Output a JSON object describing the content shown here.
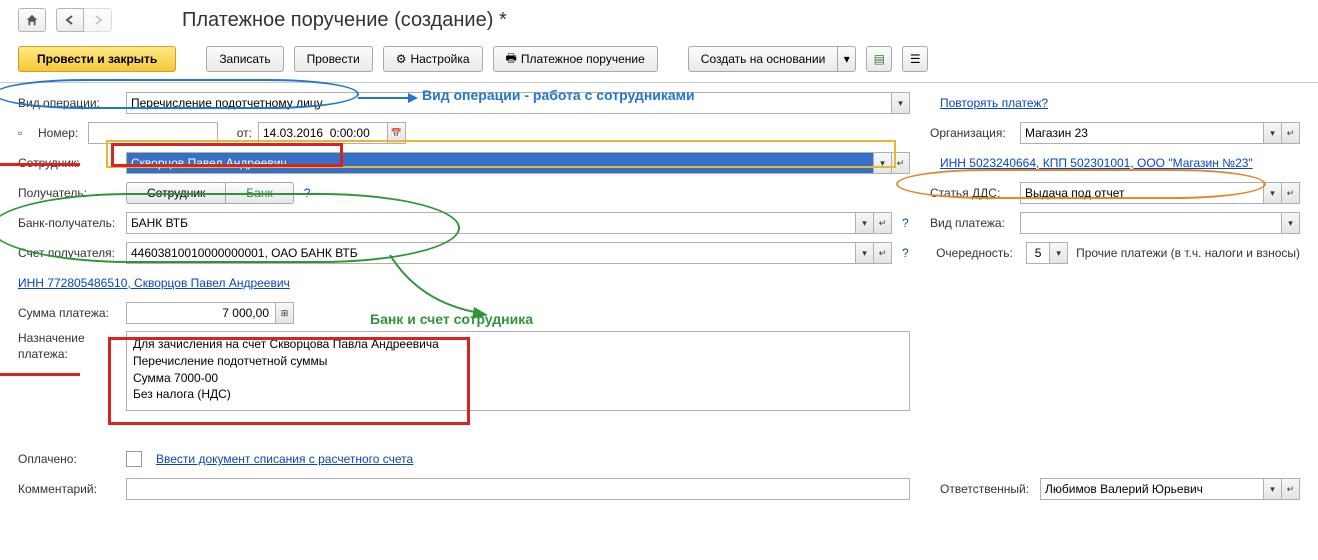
{
  "title": "Платежное поручение (создание) *",
  "toolbar": {
    "submit_close": "Провести и закрыть",
    "save": "Записать",
    "submit": "Провести",
    "settings": "Настройка",
    "payment_order": "Платежное поручение",
    "create_based": "Создать на основании"
  },
  "op_type": {
    "label": "Вид операции:",
    "value": "Перечисление подотчетному лицу"
  },
  "repeat_link": "Повторять платеж?",
  "number": {
    "label": "Номер:",
    "value": ""
  },
  "date": {
    "label": "от:",
    "value": "14.03.2016  0:00:00"
  },
  "org": {
    "label": "Организация:",
    "value": "Магазин 23"
  },
  "employee": {
    "label": "Сотрудник:",
    "value": "Скворцов Павел Андреевич"
  },
  "inn_link": "ИНН 5023240664, КПП 502301001, ООО \"Магазин №23\"",
  "recipient": {
    "label": "Получатель:",
    "tab1": "Сотрудник",
    "tab2": "Банк",
    "help": "?"
  },
  "dds": {
    "label": "Статья ДДС:",
    "value": "Выдача под отчет"
  },
  "bank": {
    "label": "Банк-получатель:",
    "value": "БАНК ВТБ"
  },
  "payment_type": {
    "label": "Вид платежа:",
    "value": ""
  },
  "account": {
    "label": "Счет получателя:",
    "value": "44603810010000000001, ОАО БАНК ВТБ"
  },
  "priority": {
    "label": "Очередность:",
    "value": "5",
    "desc": "Прочие платежи (в т.ч. налоги и взносы)"
  },
  "inn2_link": "ИНН 772805486510, Скворцов Павел Андреевич",
  "amount": {
    "label": "Сумма платежа:",
    "value": "7 000,00"
  },
  "purpose": {
    "label": "Назначение платежа:",
    "value": "Для зачисления на счет Скворцова Павла Андреевича\nПеречисление подотчетной суммы\nСумма 7000-00\nБез налога (НДС)"
  },
  "paid": {
    "label": "Оплачено:",
    "link": "Ввести документ списания с расчетного счета"
  },
  "comment": {
    "label": "Комментарий:",
    "value": ""
  },
  "responsible": {
    "label": "Ответственный:",
    "value": "Любимов Валерий Юрьевич"
  },
  "annotations": {
    "blue_text": "Вид операции - работа с сотрудниками",
    "green_text": "Банк и счет сотрудника"
  }
}
